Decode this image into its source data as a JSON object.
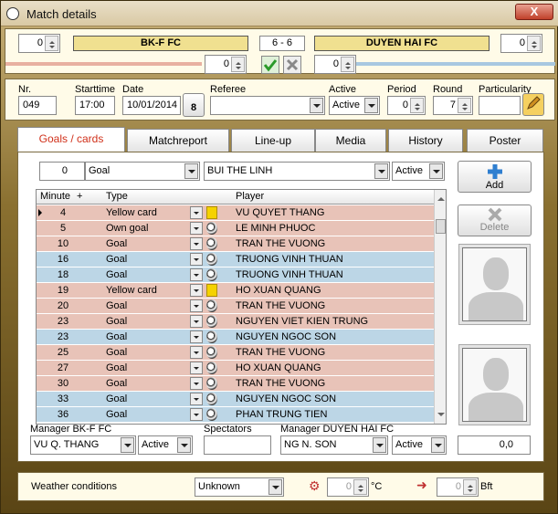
{
  "window": {
    "title": "Match details",
    "close_label": "X"
  },
  "header": {
    "home_team": "BK-F FC",
    "away_team": "DUYEN HAI FC",
    "home_spin": "0",
    "away_spin": "0",
    "score_home": "6",
    "score_sep": "-",
    "score_away": "6",
    "home_penalty": "0",
    "away_penalty": "0"
  },
  "info": {
    "nr_label": "Nr.",
    "nr": "049",
    "starttime_label": "Starttime",
    "starttime": "17:00",
    "date_label": "Date",
    "date": "10/01/2014",
    "calendar_day": "8",
    "referee_label": "Referee",
    "referee": "",
    "active_label": "Active",
    "active": "Active",
    "period_label": "Period",
    "period": "0",
    "round_label": "Round",
    "round": "7",
    "particularity_label": "Particularity",
    "particularity": ""
  },
  "tabs": [
    "Goals / cards",
    "Matchreport",
    "Line-up",
    "Media",
    "History",
    "Poster"
  ],
  "filter": {
    "minute": "0",
    "type": "Goal",
    "player": "BUI THE LINH",
    "active": "Active"
  },
  "grid": {
    "headers": {
      "minute": "Minute",
      "plus": "+",
      "type": "Type",
      "player": "Player"
    },
    "rows": [
      {
        "minute": "4",
        "type": "Yellow card",
        "player": "VU QUYET THANG",
        "color": "red",
        "icon": "card"
      },
      {
        "minute": "5",
        "type": "Own goal",
        "player": "LE MINH PHUOC",
        "color": "red",
        "icon": "ball"
      },
      {
        "minute": "10",
        "type": "Goal",
        "player": "TRAN THE VUONG",
        "color": "red",
        "icon": "ball"
      },
      {
        "minute": "16",
        "type": "Goal",
        "player": "TRUONG VINH THUAN",
        "color": "blue",
        "icon": "ball"
      },
      {
        "minute": "18",
        "type": "Goal",
        "player": "TRUONG VINH THUAN",
        "color": "blue",
        "icon": "ball"
      },
      {
        "minute": "19",
        "type": "Yellow card",
        "player": "HO XUAN QUANG",
        "color": "red",
        "icon": "card"
      },
      {
        "minute": "20",
        "type": "Goal",
        "player": "TRAN THE VUONG",
        "color": "red",
        "icon": "ball"
      },
      {
        "minute": "23",
        "type": "Goal",
        "player": "NGUYEN VIET KIEN TRUNG",
        "color": "red",
        "icon": "ball"
      },
      {
        "minute": "23",
        "type": "Goal",
        "player": "NGUYEN NGOC SON",
        "color": "blue",
        "icon": "ball"
      },
      {
        "minute": "25",
        "type": "Goal",
        "player": "TRAN THE VUONG",
        "color": "red",
        "icon": "ball"
      },
      {
        "minute": "27",
        "type": "Goal",
        "player": "HO XUAN QUANG",
        "color": "red",
        "icon": "ball"
      },
      {
        "minute": "30",
        "type": "Goal",
        "player": "TRAN THE VUONG",
        "color": "red",
        "icon": "ball"
      },
      {
        "minute": "33",
        "type": "Goal",
        "player": "NGUYEN NGOC SON",
        "color": "blue",
        "icon": "ball"
      },
      {
        "minute": "36",
        "type": "Goal",
        "player": "PHAN TRUNG TIEN",
        "color": "blue",
        "icon": "ball"
      }
    ]
  },
  "buttons": {
    "add": "Add",
    "delete": "Delete"
  },
  "footer": {
    "manager_home_label": "Manager BK-F FC",
    "manager_home": "VU Q. THANG",
    "manager_home_active": "Active",
    "spectators_label": "Spectators",
    "spectators": "",
    "manager_away_label": "Manager DUYEN HAI FC",
    "manager_away": "NG N. SON",
    "manager_away_active": "Active",
    "rating": "0,0"
  },
  "weather": {
    "label": "Weather conditions",
    "value": "Unknown",
    "temp": "0",
    "temp_unit": "°C",
    "wind": "0",
    "wind_unit": "Bft"
  },
  "colors": {
    "home_bar": "#e8b0a0",
    "away_bar": "#a8c8e0",
    "active_tab": "#d0301a"
  }
}
